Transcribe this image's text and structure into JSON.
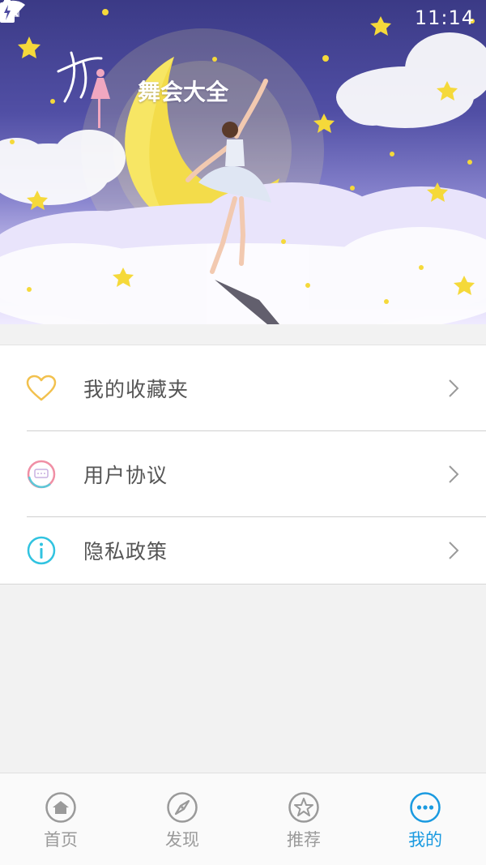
{
  "status_bar": {
    "time": "11:14"
  },
  "banner": {
    "title": "舞会大全"
  },
  "menu": {
    "items": [
      {
        "label": "我的收藏夹",
        "icon": "heart-icon"
      },
      {
        "label": "用户协议",
        "icon": "chat-bubble-icon"
      },
      {
        "label": "隐私政策",
        "icon": "info-icon"
      }
    ]
  },
  "bottom_nav": {
    "items": [
      {
        "label": "首页",
        "icon": "home-icon",
        "active": false
      },
      {
        "label": "发现",
        "icon": "compass-icon",
        "active": false
      },
      {
        "label": "推荐",
        "icon": "star-icon",
        "active": false
      },
      {
        "label": "我的",
        "icon": "more-icon",
        "active": true
      }
    ]
  },
  "colors": {
    "active": "#1a9ae0",
    "inactive": "#9a9a9a",
    "heart": "#f2c14e",
    "info": "#31c3e0",
    "label": "#555555"
  }
}
